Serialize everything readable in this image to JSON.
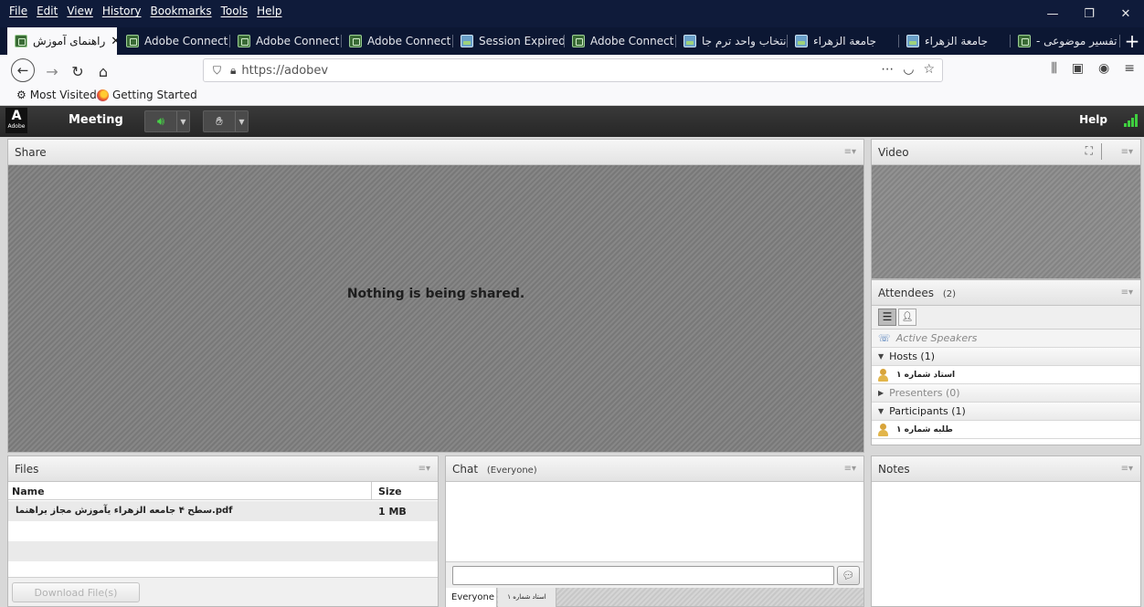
{
  "browser": {
    "menu": [
      "File",
      "Edit",
      "View",
      "History",
      "Bookmarks",
      "Tools",
      "Help"
    ],
    "window_controls": [
      "—",
      "❐",
      "✕"
    ],
    "tabs": [
      {
        "label": "راهنمای آموزش",
        "close": "✕"
      },
      {
        "label": "Adobe Connect C"
      },
      {
        "label": "Adobe Connect C"
      },
      {
        "label": "Adobe Connect C"
      },
      {
        "label": "Session Expired"
      },
      {
        "label": "Adobe Connect I"
      },
      {
        "label": "انتخاب واحد ترم جا"
      },
      {
        "label": "جامعة الزهراء"
      },
      {
        "label": "جامعة الزهراء"
      },
      {
        "label": "تفسیر موضوعی -"
      }
    ],
    "new_tab": "+",
    "url": "https://adobev",
    "bookmarks": [
      {
        "label": "Most Visited",
        "icon": "gear-icon"
      },
      {
        "label": "Getting Started",
        "icon": "firefox-icon"
      }
    ]
  },
  "connect": {
    "logo_text": "Adobe",
    "meeting_menu": "Meeting",
    "help": "Help",
    "share": {
      "title": "Share",
      "message": "Nothing is being shared."
    },
    "video": {
      "title": "Video"
    },
    "attendees": {
      "title": "Attendees",
      "count": "(2)",
      "active_speakers": "Active Speakers",
      "hosts": "Hosts (1)",
      "host_name": "استاد شماره ۱",
      "presenters": "Presenters (0)",
      "participants": "Participants (1)",
      "participant_name": "طلبه شماره ۱"
    },
    "files": {
      "title": "Files",
      "columns": [
        "Name",
        "Size"
      ],
      "rows": [
        {
          "name": "pdf.سطح ۴ جامعه الزهراء یآموزش مجاز یراهنما",
          "size": "1 MB"
        }
      ],
      "download_button": "Download File(s)"
    },
    "chat": {
      "title": "Chat",
      "scope": "(Everyone)",
      "tabs": [
        "Everyone",
        "استاد شماره ۱"
      ]
    },
    "notes": {
      "title": "Notes"
    }
  },
  "colors": {
    "menubar": "#0f1b3a",
    "tabbar": "#0c1733",
    "connect_bar": "#2f2f2f",
    "share_bg": "#7e7e7e"
  }
}
